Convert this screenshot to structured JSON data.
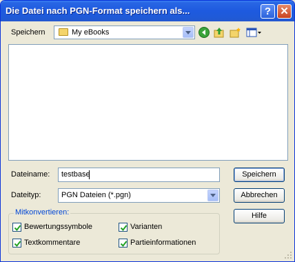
{
  "window": {
    "title": "Die Datei nach PGN-Format speichern als..."
  },
  "save_in": {
    "label": "Speichern",
    "folder": "My eBooks"
  },
  "toolbar": {
    "back_icon": "back-icon",
    "up_icon": "up-folder-icon",
    "newfolder_icon": "new-folder-icon",
    "views_icon": "views-menu-icon"
  },
  "filename": {
    "label": "Dateiname:",
    "value": "testbase"
  },
  "filetype": {
    "label": "Dateityp:",
    "value": "PGN Dateien (*.pgn)"
  },
  "buttons": {
    "save": "Speichern",
    "cancel": "Abbrechen",
    "help": "Hilfe"
  },
  "group": {
    "title": "Mitkonvertieren:",
    "options": [
      {
        "label": "Bewertungssymbole",
        "checked": true
      },
      {
        "label": "Varianten",
        "checked": true
      },
      {
        "label": "Textkommentare",
        "checked": true
      },
      {
        "label": "Partieinformationen",
        "checked": true
      }
    ]
  },
  "colors": {
    "titlebar": "#1f5ad8",
    "accent_blue": "#0046d5",
    "check_green": "#21a121"
  }
}
